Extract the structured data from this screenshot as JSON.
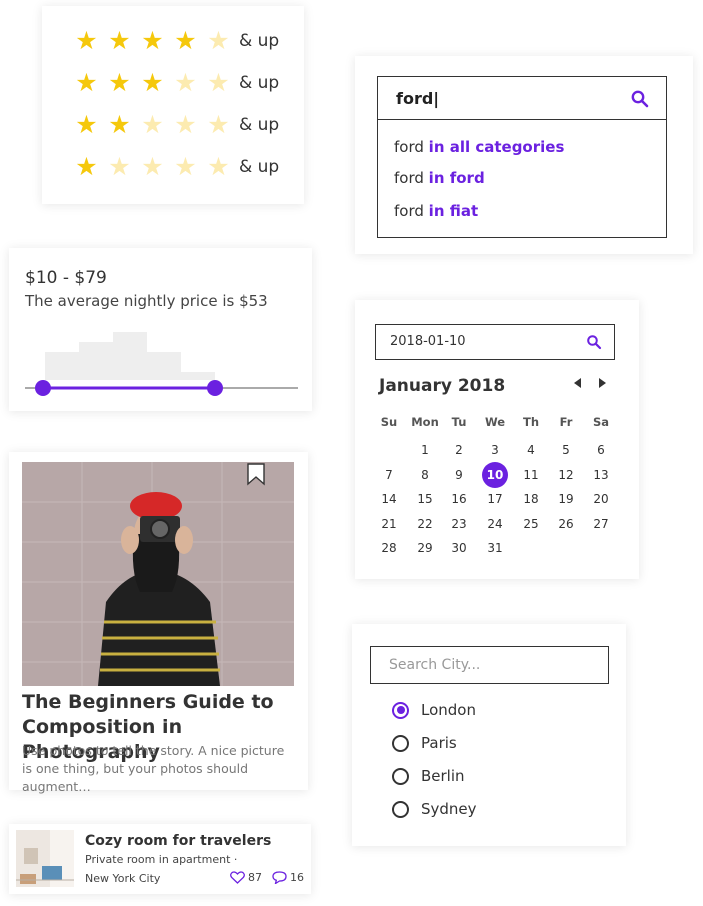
{
  "rating": {
    "suffix": "& up",
    "rows": [
      {
        "stars": 4
      },
      {
        "stars": 3
      },
      {
        "stars": 2
      },
      {
        "stars": 1
      }
    ],
    "colors": {
      "on": "#F5C80C",
      "off": "#FCEBB0"
    }
  },
  "search": {
    "value": "ford|",
    "icon": "search-icon",
    "suggestions": [
      {
        "term": "ford",
        "scope": "in all categories"
      },
      {
        "term": "ford",
        "scope": "in ford"
      },
      {
        "term": "ford",
        "scope": "in fiat"
      }
    ]
  },
  "price": {
    "range": "$10 - $79",
    "average": "The average nightly price is $53",
    "selected_range_fraction": [
      0.07,
      0.69
    ]
  },
  "article": {
    "title": "The Beginners Guide to Composition in Photography",
    "description": "Use photos to tell the story. A nice picture is one thing, but your photos should augment…",
    "bookmark_icon": "bookmark-icon"
  },
  "listing": {
    "title": "Cozy room for travelers",
    "subtitle": "Private room in apartment ·",
    "city": "New York City",
    "likes": "87",
    "comments": "16"
  },
  "calendar": {
    "date_value": "2018-01-10",
    "month": "January 2018",
    "weekdays": [
      "Su",
      "Mon",
      "Tu",
      "We",
      "Th",
      "Fr",
      "Sa"
    ],
    "first_weekday_index": 1,
    "days_in_month": 31,
    "selected_day": 10
  },
  "city": {
    "placeholder": "Search City...",
    "options": [
      "London",
      "Paris",
      "Berlin",
      "Sydney"
    ],
    "selected": "London"
  },
  "colors": {
    "accent": "#6B21E0",
    "star": "#F5C80C"
  }
}
